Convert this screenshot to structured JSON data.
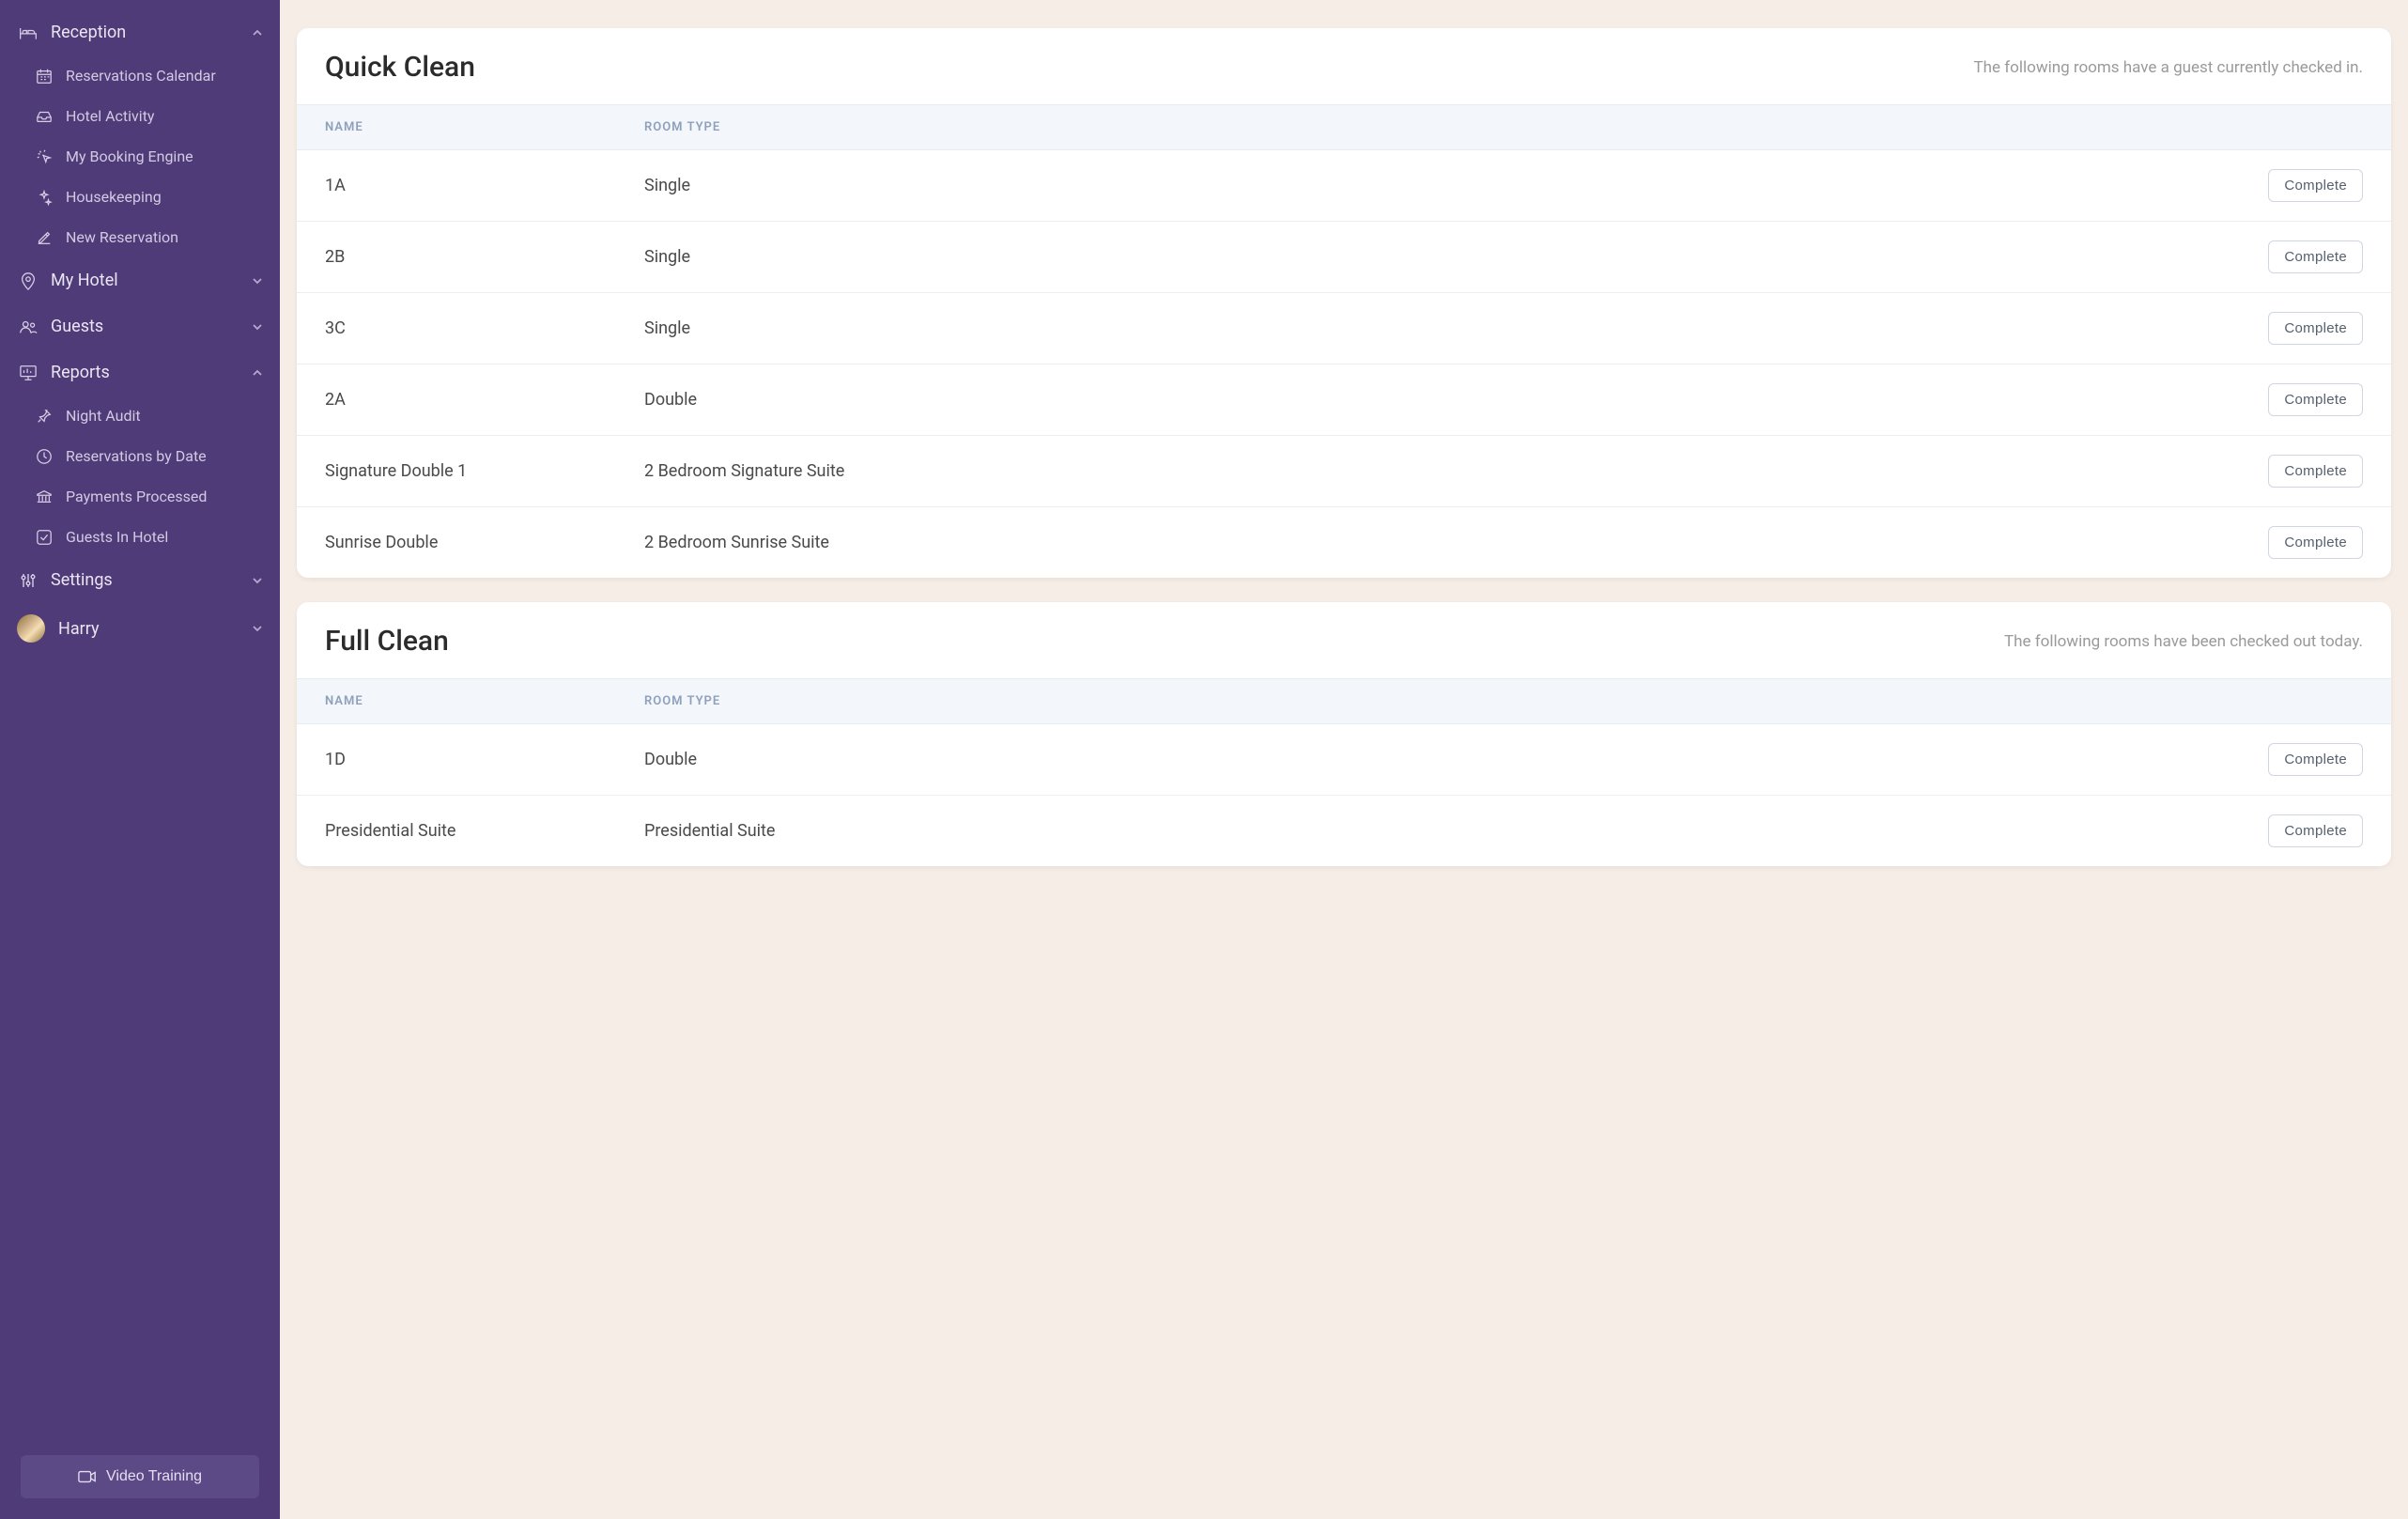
{
  "sidebar": {
    "sections": {
      "reception": {
        "label": "Reception",
        "items": [
          {
            "id": "reservations-calendar",
            "label": "Reservations Calendar"
          },
          {
            "id": "hotel-activity",
            "label": "Hotel Activity"
          },
          {
            "id": "my-booking-engine",
            "label": "My Booking Engine"
          },
          {
            "id": "housekeeping",
            "label": "Housekeeping"
          },
          {
            "id": "new-reservation",
            "label": "New Reservation"
          }
        ]
      },
      "my_hotel": {
        "label": "My Hotel"
      },
      "guests": {
        "label": "Guests"
      },
      "reports": {
        "label": "Reports",
        "items": [
          {
            "id": "night-audit",
            "label": "Night Audit"
          },
          {
            "id": "reservations-by-date",
            "label": "Reservations by Date"
          },
          {
            "id": "payments-processed",
            "label": "Payments Processed"
          },
          {
            "id": "guests-in-hotel",
            "label": "Guests In Hotel"
          }
        ]
      },
      "settings": {
        "label": "Settings"
      }
    },
    "user": {
      "name": "Harry"
    },
    "video_training_label": "Video Training"
  },
  "col_headers": {
    "name": "NAME",
    "room_type": "ROOM TYPE"
  },
  "complete_button_label": "Complete",
  "panels": {
    "quick_clean": {
      "title": "Quick Clean",
      "subtitle": "The following rooms have a guest currently checked in.",
      "rows": [
        {
          "name": "1A",
          "room_type": "Single"
        },
        {
          "name": "2B",
          "room_type": "Single"
        },
        {
          "name": "3C",
          "room_type": "Single"
        },
        {
          "name": "2A",
          "room_type": "Double"
        },
        {
          "name": "Signature Double 1",
          "room_type": "2 Bedroom Signature Suite"
        },
        {
          "name": "Sunrise Double",
          "room_type": "2 Bedroom Sunrise Suite"
        }
      ]
    },
    "full_clean": {
      "title": "Full Clean",
      "subtitle": "The following rooms have been checked out today.",
      "rows": [
        {
          "name": "1D",
          "room_type": "Double"
        },
        {
          "name": "Presidential Suite",
          "room_type": "Presidential Suite"
        }
      ]
    }
  }
}
